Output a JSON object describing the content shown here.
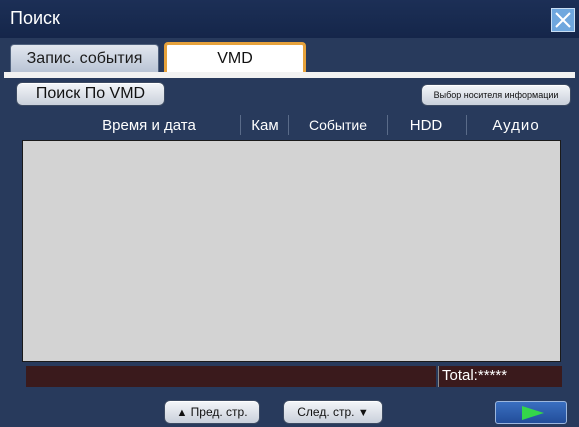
{
  "window": {
    "title": "Поиск",
    "close_icon": "close-icon"
  },
  "tabs": [
    {
      "label": "Запис. события",
      "active": false
    },
    {
      "label": "VMD",
      "active": true
    }
  ],
  "toolbar": {
    "search_vmd_label": "Поиск По VMD",
    "media_select_label": "Выбор носителя информации"
  },
  "table": {
    "columns": [
      "Время и дата",
      "Кам",
      "Событие",
      "HDD",
      "Аудио"
    ],
    "rows": []
  },
  "status": {
    "total_label": "Total:*****"
  },
  "pager": {
    "prev_label": "Пред. стр.",
    "next_label": "След. стр.",
    "prev_icon": "triangle-up-icon",
    "next_icon": "triangle-down-icon"
  },
  "go_button": {
    "icon": "play-arrow-icon",
    "arrow_color": "#34d64a"
  },
  "colors": {
    "window_bg": "#283a5c",
    "active_tab_border": "#e6a23c",
    "table_bg": "#d3d3d3",
    "status_bg": "#3a1a1c"
  }
}
